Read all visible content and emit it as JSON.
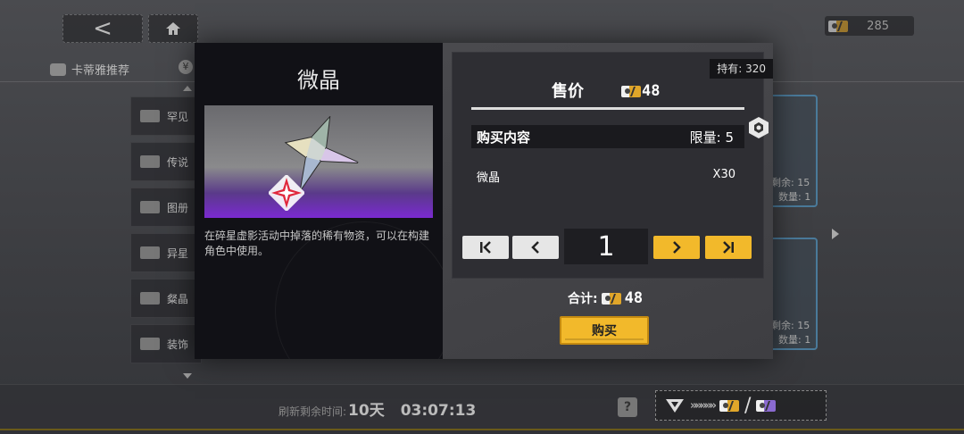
{
  "background": {
    "nav": {
      "back_glyph": "<"
    },
    "currency": {
      "value": "285"
    },
    "tabs": [
      {
        "label": "卡蒂雅推荐"
      },
      {
        "label": "¥"
      }
    ],
    "sidebar": [
      {
        "label": "罕见"
      },
      {
        "label": "传说"
      },
      {
        "label": "图册"
      },
      {
        "label": "异星"
      },
      {
        "label": "粲晶"
      },
      {
        "label": "装饰"
      }
    ],
    "cards": [
      {
        "line1": "剩余: 15",
        "line2": "数量: 1"
      },
      {
        "line1": "剩余: 15",
        "line2": "数量: 1"
      }
    ],
    "refresh": {
      "label": "刷新剩余时间:",
      "days": "10天",
      "time": "03:07:13"
    },
    "help_glyph": "?",
    "exchange": {
      "chevrons": "»»»»»",
      "slash": "/"
    }
  },
  "modal": {
    "item_name": "微晶",
    "description": "在碎星虚影活动中掉落的稀有物资，可以在构建角色中使用。",
    "owned": "持有: 320",
    "price_label": "售价",
    "price_value": "48",
    "contents_header": "购买内容",
    "limit": "限量: 5",
    "content_item": "微晶",
    "content_qty": "X30",
    "quantity": "1",
    "total_label": "合计:",
    "total_value": "48",
    "buy_label": "购买"
  },
  "colors": {
    "accent_yellow": "#f2b92b",
    "item_bg_purple": "#7a2ad0",
    "panel_dark": "#111116"
  }
}
